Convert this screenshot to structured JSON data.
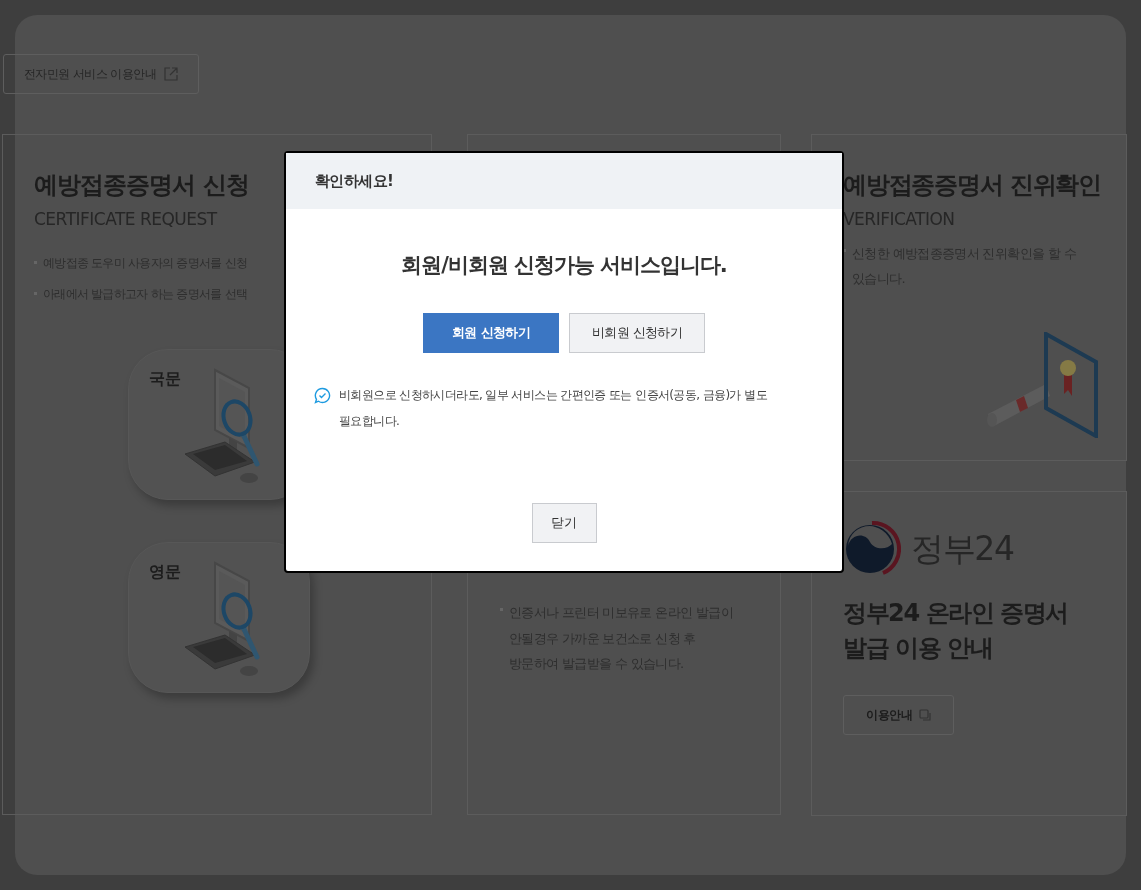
{
  "top_link": {
    "label": "전자민원 서비스 이용안내"
  },
  "cards": [
    {
      "kind": "request",
      "title": "예방접종증명서 신청",
      "subtitle": "CERTIFICATE REQUEST",
      "bullets": [
        "예방접종 도우미 사용자의 증명서를 신청",
        "아래에서 발급하고자 하는 증명서를 선택"
      ],
      "tiles": [
        {
          "label": "국문"
        },
        {
          "label": "영문"
        }
      ]
    },
    {
      "kind": "visit",
      "bullet_lines": [
        "인증서나 프린터 미보유로 온라인 발급이",
        "안될경우 가까운 보건소로 신청 후",
        "방문하여 발급받을 수 있습니다."
      ]
    },
    {
      "kind": "verify",
      "title": "예방접종증명서 진위확인",
      "subtitle": "VERIFICATION",
      "bullet_lines": [
        "신청한 예방접종증명서 진위확인을 할 수",
        "있습니다."
      ]
    },
    {
      "kind": "gov24",
      "logo_text": "정부24",
      "title_lines": [
        "정부24 온라인 증명서",
        "발급 이용 안내"
      ],
      "button": "이용안내"
    }
  ],
  "dialog": {
    "title": "확인하세요!",
    "heading": "회원/비회원 신청가능 서비스입니다.",
    "buttons": [
      {
        "label": "회원 신청하기",
        "kind": "primary"
      },
      {
        "label": "비회원 신청하기",
        "kind": "secondary"
      }
    ],
    "note_lines": [
      "비회원으로 신청하시더라도, 일부 서비스는 간편인증 또는 인증서(공동, 금융)가 별도",
      "필요합니다."
    ],
    "close": "닫기"
  }
}
